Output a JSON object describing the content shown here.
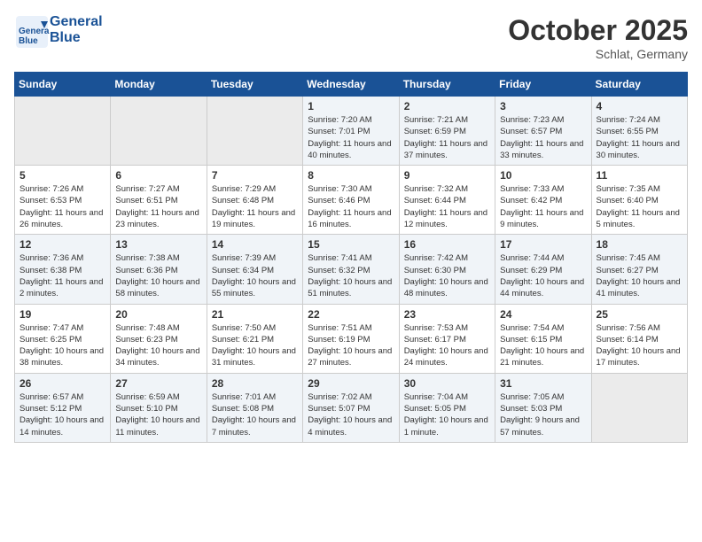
{
  "header": {
    "logo_text_1": "General",
    "logo_text_2": "Blue",
    "month": "October 2025",
    "location": "Schlat, Germany"
  },
  "weekdays": [
    "Sunday",
    "Monday",
    "Tuesday",
    "Wednesday",
    "Thursday",
    "Friday",
    "Saturday"
  ],
  "weeks": [
    [
      {
        "day": "",
        "empty": true
      },
      {
        "day": "",
        "empty": true
      },
      {
        "day": "",
        "empty": true
      },
      {
        "day": "1",
        "sunrise": "7:20 AM",
        "sunset": "7:01 PM",
        "daylight": "11 hours and 40 minutes."
      },
      {
        "day": "2",
        "sunrise": "7:21 AM",
        "sunset": "6:59 PM",
        "daylight": "11 hours and 37 minutes."
      },
      {
        "day": "3",
        "sunrise": "7:23 AM",
        "sunset": "6:57 PM",
        "daylight": "11 hours and 33 minutes."
      },
      {
        "day": "4",
        "sunrise": "7:24 AM",
        "sunset": "6:55 PM",
        "daylight": "11 hours and 30 minutes."
      }
    ],
    [
      {
        "day": "5",
        "sunrise": "7:26 AM",
        "sunset": "6:53 PM",
        "daylight": "11 hours and 26 minutes."
      },
      {
        "day": "6",
        "sunrise": "7:27 AM",
        "sunset": "6:51 PM",
        "daylight": "11 hours and 23 minutes."
      },
      {
        "day": "7",
        "sunrise": "7:29 AM",
        "sunset": "6:48 PM",
        "daylight": "11 hours and 19 minutes."
      },
      {
        "day": "8",
        "sunrise": "7:30 AM",
        "sunset": "6:46 PM",
        "daylight": "11 hours and 16 minutes."
      },
      {
        "day": "9",
        "sunrise": "7:32 AM",
        "sunset": "6:44 PM",
        "daylight": "11 hours and 12 minutes."
      },
      {
        "day": "10",
        "sunrise": "7:33 AM",
        "sunset": "6:42 PM",
        "daylight": "11 hours and 9 minutes."
      },
      {
        "day": "11",
        "sunrise": "7:35 AM",
        "sunset": "6:40 PM",
        "daylight": "11 hours and 5 minutes."
      }
    ],
    [
      {
        "day": "12",
        "sunrise": "7:36 AM",
        "sunset": "6:38 PM",
        "daylight": "11 hours and 2 minutes."
      },
      {
        "day": "13",
        "sunrise": "7:38 AM",
        "sunset": "6:36 PM",
        "daylight": "10 hours and 58 minutes."
      },
      {
        "day": "14",
        "sunrise": "7:39 AM",
        "sunset": "6:34 PM",
        "daylight": "10 hours and 55 minutes."
      },
      {
        "day": "15",
        "sunrise": "7:41 AM",
        "sunset": "6:32 PM",
        "daylight": "10 hours and 51 minutes."
      },
      {
        "day": "16",
        "sunrise": "7:42 AM",
        "sunset": "6:30 PM",
        "daylight": "10 hours and 48 minutes."
      },
      {
        "day": "17",
        "sunrise": "7:44 AM",
        "sunset": "6:29 PM",
        "daylight": "10 hours and 44 minutes."
      },
      {
        "day": "18",
        "sunrise": "7:45 AM",
        "sunset": "6:27 PM",
        "daylight": "10 hours and 41 minutes."
      }
    ],
    [
      {
        "day": "19",
        "sunrise": "7:47 AM",
        "sunset": "6:25 PM",
        "daylight": "10 hours and 38 minutes."
      },
      {
        "day": "20",
        "sunrise": "7:48 AM",
        "sunset": "6:23 PM",
        "daylight": "10 hours and 34 minutes."
      },
      {
        "day": "21",
        "sunrise": "7:50 AM",
        "sunset": "6:21 PM",
        "daylight": "10 hours and 31 minutes."
      },
      {
        "day": "22",
        "sunrise": "7:51 AM",
        "sunset": "6:19 PM",
        "daylight": "10 hours and 27 minutes."
      },
      {
        "day": "23",
        "sunrise": "7:53 AM",
        "sunset": "6:17 PM",
        "daylight": "10 hours and 24 minutes."
      },
      {
        "day": "24",
        "sunrise": "7:54 AM",
        "sunset": "6:15 PM",
        "daylight": "10 hours and 21 minutes."
      },
      {
        "day": "25",
        "sunrise": "7:56 AM",
        "sunset": "6:14 PM",
        "daylight": "10 hours and 17 minutes."
      }
    ],
    [
      {
        "day": "26",
        "sunrise": "6:57 AM",
        "sunset": "5:12 PM",
        "daylight": "10 hours and 14 minutes."
      },
      {
        "day": "27",
        "sunrise": "6:59 AM",
        "sunset": "5:10 PM",
        "daylight": "10 hours and 11 minutes."
      },
      {
        "day": "28",
        "sunrise": "7:01 AM",
        "sunset": "5:08 PM",
        "daylight": "10 hours and 7 minutes."
      },
      {
        "day": "29",
        "sunrise": "7:02 AM",
        "sunset": "5:07 PM",
        "daylight": "10 hours and 4 minutes."
      },
      {
        "day": "30",
        "sunrise": "7:04 AM",
        "sunset": "5:05 PM",
        "daylight": "10 hours and 1 minute."
      },
      {
        "day": "31",
        "sunrise": "7:05 AM",
        "sunset": "5:03 PM",
        "daylight": "9 hours and 57 minutes."
      },
      {
        "day": "",
        "empty": true
      }
    ]
  ]
}
